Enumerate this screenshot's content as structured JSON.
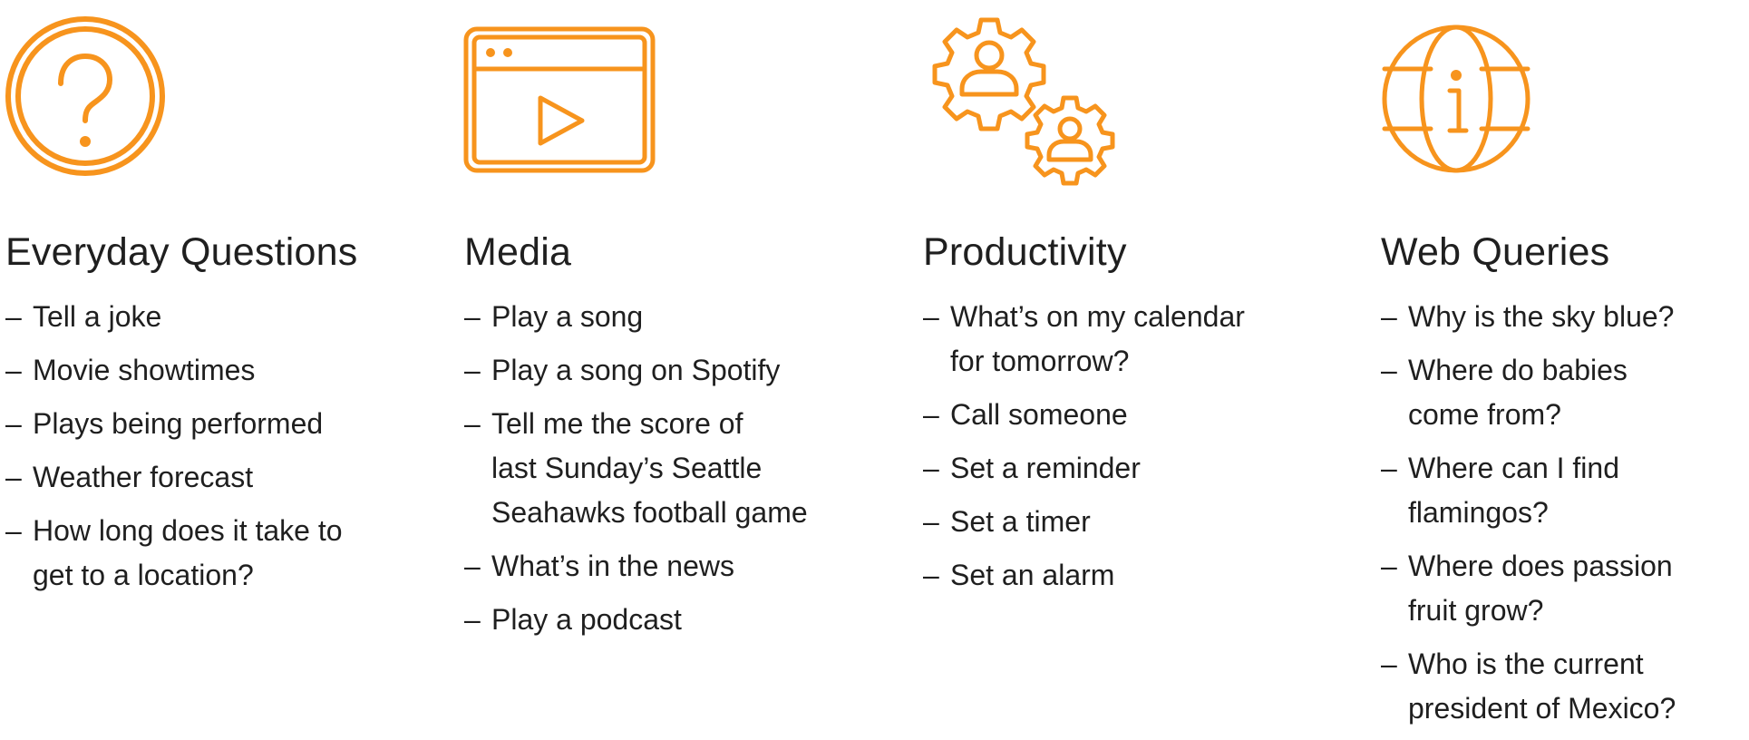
{
  "accent_color": "#F7941D",
  "dash": "–",
  "columns": [
    {
      "id": "everyday",
      "icon": "question-circle-icon",
      "title": "Everyday Questions",
      "items": [
        "Tell a joke",
        "Movie showtimes",
        "Plays being performed",
        "Weather forecast",
        "How long does it take to\nget to a location?"
      ]
    },
    {
      "id": "media",
      "icon": "video-player-icon",
      "title": "Media",
      "items": [
        "Play a song",
        "Play a song on Spotify",
        "Tell me the score of\nlast Sunday’s Seattle\nSeahawks football game",
        "What’s in the news",
        "Play a podcast"
      ]
    },
    {
      "id": "productivity",
      "icon": "gear-people-icon",
      "title": "Productivity",
      "items": [
        "What’s on my calendar\nfor tomorrow?",
        "Call someone",
        "Set a reminder",
        "Set a timer",
        "Set an alarm"
      ]
    },
    {
      "id": "web",
      "icon": "globe-info-icon",
      "title": "Web Queries",
      "items": [
        "Why is the sky blue?",
        "Where do babies\ncome from?",
        "Where can I find\nflamingos?",
        "Where does passion\nfruit grow?",
        "Who is the current\npresident of Mexico?"
      ]
    }
  ]
}
